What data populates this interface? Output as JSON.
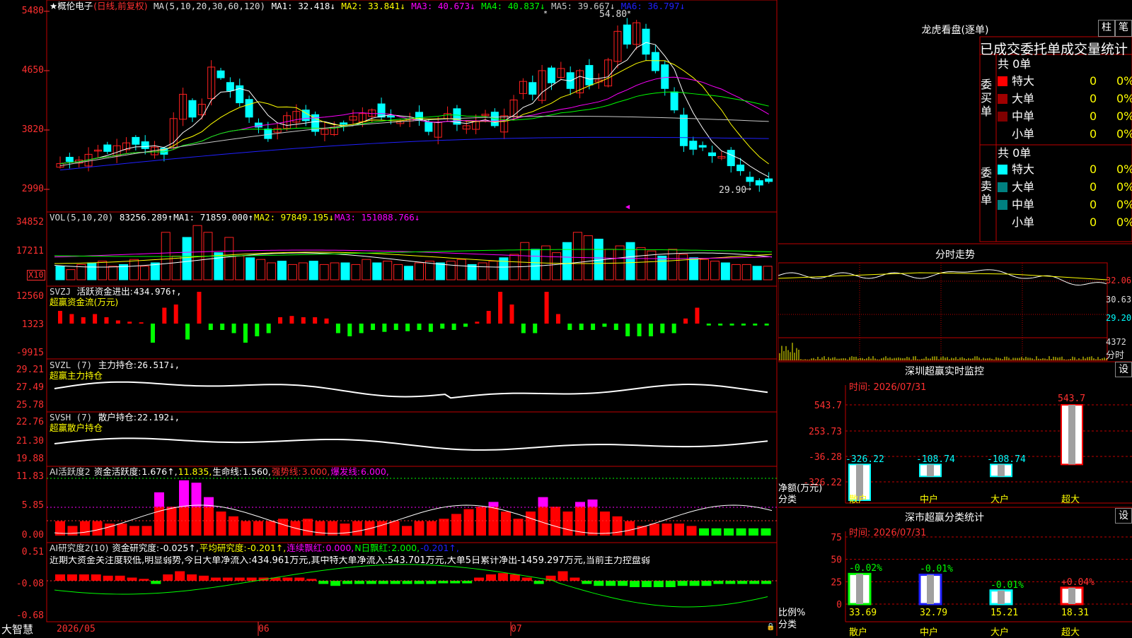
{
  "stock": {
    "title": "★概伦电子",
    "mode": "(日线,前复权)",
    "ma_label": "MA(5,10,20,30,60,120)",
    "ma": [
      {
        "k": "MA1:",
        "v": "32.418↓",
        "c": "#ffffff"
      },
      {
        "k": "MA2:",
        "v": "33.841↓",
        "c": "#ffff00"
      },
      {
        "k": "MA3:",
        "v": "40.673↓",
        "c": "#ff00ff"
      },
      {
        "k": "MA4:",
        "v": "40.837↓",
        "c": "#00ff00"
      },
      {
        "k": "MA5:",
        "v": "39.667↓",
        "c": "#c8c8c8"
      },
      {
        "k": "MA6:",
        "v": "36.797↓",
        "c": "#2020ff"
      }
    ],
    "high_mark": "54.80",
    "low_mark": "29.90"
  },
  "main_yticks": [
    "5480",
    "4650",
    "3820",
    "2990"
  ],
  "vol": {
    "label": "VOL(5,10,20)",
    "value": "83256.289↑",
    "ma": [
      {
        "k": "MA1:",
        "v": "71859.000↑",
        "c": "#ffffff"
      },
      {
        "k": "MA2:",
        "v": "97849.195↓",
        "c": "#ffff00"
      },
      {
        "k": "MA3:",
        "v": "151088.766↓",
        "c": "#ff00ff"
      }
    ],
    "yticks": [
      "34852",
      "17211"
    ],
    "unit": "X10"
  },
  "svzj": {
    "label": "SVZJ",
    "title": "活跃资金进出:",
    "value": "434.976↑,",
    "sub": "超赢资金流(万元)",
    "yticks": [
      "12560",
      "1323",
      "-9915"
    ]
  },
  "svzl": {
    "label": "SVZL (7)",
    "title": "主力持仓:",
    "value": "26.517↓,",
    "sub": "超赢主力持仓",
    "yticks": [
      "29.21",
      "27.49",
      "25.78"
    ]
  },
  "svsh": {
    "label": "SVSH (7)",
    "title": "散户持仓:",
    "value": "22.192↓,",
    "sub": "超赢散户持仓",
    "yticks": [
      "22.76",
      "21.30",
      "19.88"
    ]
  },
  "ai1": {
    "label": "AI活跃度2",
    "t1": "资金活跃度:",
    "v1": "1.676↑,",
    "v2": "11.835,",
    "t3": "生命线:",
    "v3": "1.560,",
    "t4": "强势线:",
    "v4": "3.000,",
    "t5": "爆发线:",
    "v5": "6.000,",
    "yticks": [
      "11.83",
      "5.85",
      "0.00"
    ]
  },
  "ai2": {
    "label": "AI研究度2(10)",
    "t1": "资金研究度:",
    "v1": "-0.025↑,",
    "t2": "平均研究度:",
    "v2": "-0.201↑,",
    "t3": "连续飘红:",
    "v3": "0.000,",
    "t4": "N日飘红:",
    "v4": "2.000,",
    "v5": "-0.201↑,",
    "note": "近期大资金关注度较低,明显弱势,今日大单净流入:434.961万元,其中特大单净流入:543.701万元,大单5日累计净出-1459.297万元,当前主力控盘弱",
    "yticks": [
      "0.51",
      "-0.08",
      "-0.68"
    ]
  },
  "xaxis": {
    "brand": "大智慧",
    "dates": [
      "2026/05",
      "06",
      "07"
    ]
  },
  "right": {
    "lhb_title": "龙虎看盘(逐单)",
    "btn_zhu": "柱",
    "btn_bi": "笔",
    "stat_title": "已成交委托单成交量统计",
    "buy_label": "委买单",
    "sell_label": "委卖单",
    "buy": {
      "total": "共 0单",
      "rows": [
        {
          "n": "特大",
          "v": "0",
          "p": "0%",
          "c": "#ff0000"
        },
        {
          "n": "大单",
          "v": "0",
          "p": "0%",
          "c": "#a00000"
        },
        {
          "n": "中单",
          "v": "0",
          "p": "0%",
          "c": "#800000"
        },
        {
          "n": "小单",
          "v": "0",
          "p": "0%",
          "c": "#000000"
        }
      ]
    },
    "sell": {
      "total": "共 0单",
      "rows": [
        {
          "n": "特大",
          "v": "0",
          "p": "0%",
          "c": "#00ffff"
        },
        {
          "n": "大单",
          "v": "0",
          "p": "0%",
          "c": "#008080"
        },
        {
          "n": "中单",
          "v": "0",
          "p": "0%",
          "c": "#008080"
        },
        {
          "n": "小单",
          "v": "0",
          "p": "0%",
          "c": "#000000"
        }
      ]
    },
    "fs_title": "分时走势",
    "fs_yticks": [
      "32.06",
      "30.63",
      "29.20"
    ],
    "fs_vol": "4372",
    "fs_unit": "分时",
    "mon_title": "深圳超赢实时监控",
    "mon_btn": "设",
    "mon_time": "时间: 2026/07/31",
    "mon_yticks": [
      "543.7",
      "253.73",
      "-36.28",
      "-326.22"
    ],
    "mon_bars": [
      {
        "cat": "散户",
        "val": -326.22,
        "label": "-326.22"
      },
      {
        "cat": "中户",
        "val": -108.74,
        "label": "-108.74"
      },
      {
        "cat": "大户",
        "val": -108.74,
        "label": "-108.74"
      },
      {
        "cat": "超大",
        "val": 543.7,
        "label": "543.7"
      }
    ],
    "mon_ylabel": "净额(万元)",
    "mon_xlabel": "分类",
    "cls_title": "深市超赢分类统计",
    "cls_btn": "设",
    "cls_time": "时间: 2026/07/31",
    "cls_yticks": [
      "75",
      "50",
      "25",
      "0"
    ],
    "cls_bars": [
      {
        "cat": "散户",
        "val": 33.69,
        "chg": "-0.02%",
        "label": "33.69",
        "c": "#00ff00"
      },
      {
        "cat": "中户",
        "val": 32.79,
        "chg": "-0.01%",
        "label": "32.79",
        "c": "#2020ff"
      },
      {
        "cat": "大户",
        "val": 15.21,
        "chg": "-0.01%",
        "label": "15.21",
        "c": "#00ffff"
      },
      {
        "cat": "超大",
        "val": 18.31,
        "chg": "+0.04%",
        "label": "18.31",
        "c": "#ff0000"
      }
    ],
    "cls_ylabel": "比例%",
    "cls_xlabel": "分类"
  },
  "chart_data": {
    "type": "bar",
    "title": "深圳超赢实时监控",
    "categories": [
      "散户",
      "中户",
      "大户",
      "超大"
    ],
    "values": [
      -326.22,
      -108.74,
      -108.74,
      543.7
    ],
    "ylabel": "净额(万元)",
    "xlabel": "分类",
    "ylim": [
      -326.22,
      543.7
    ]
  }
}
